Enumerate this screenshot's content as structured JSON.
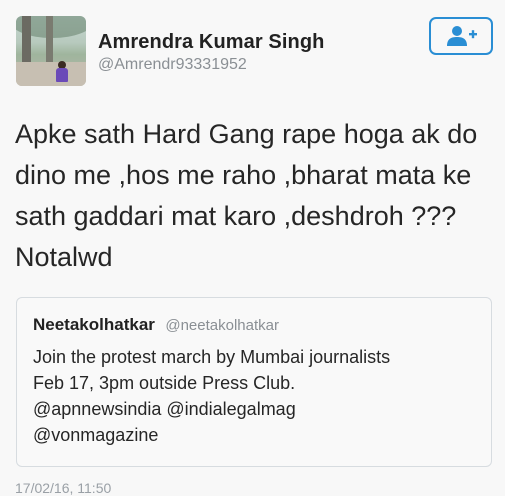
{
  "tweet": {
    "author": {
      "display_name": "Amrendra Kumar Singh",
      "handle": "@Amrendr93331952"
    },
    "text": "Apke sath Hard Gang rape hoga ak do\ndino me ,hos me raho ,bharat mata ke\nsath gaddari mat karo ,deshdroh ???\nNotalwd",
    "timestamp": "17/02/16, 11:50"
  },
  "follow_button": {
    "icon": "add-user-icon",
    "color": "#2a8ed4"
  },
  "quoted_tweet": {
    "display_name": "Neetakolhatkar",
    "handle": "@neetakolhatkar",
    "text": "Join the protest march by Mumbai journalists\nFeb 17, 3pm outside Press Club.\n@apnnewsindia @indialegalmag\n@vonmagazine"
  }
}
